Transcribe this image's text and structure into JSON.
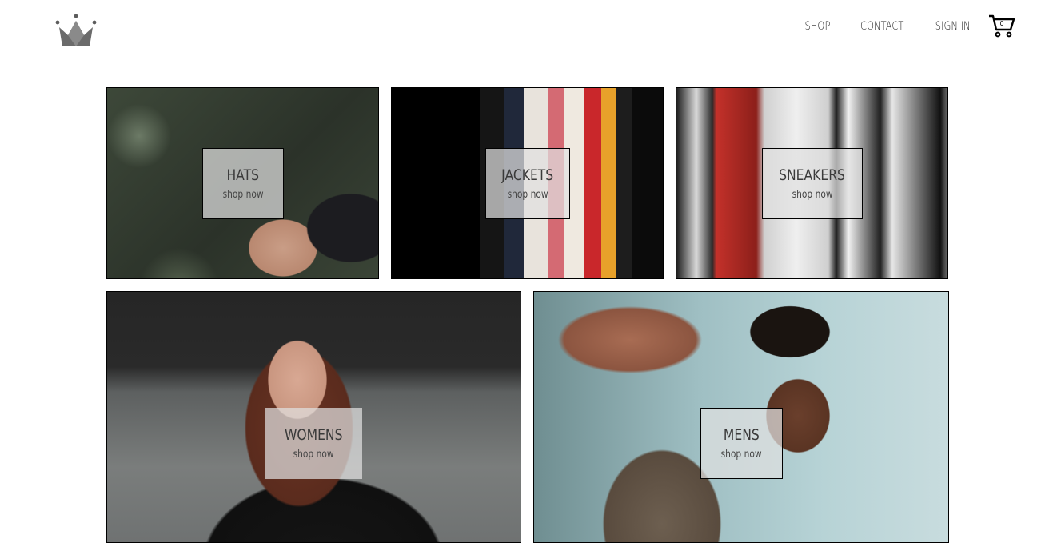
{
  "header": {
    "logo_icon": "crown-icon",
    "nav": [
      {
        "label": "SHOP"
      },
      {
        "label": "CONTACT"
      },
      {
        "label": "SIGN IN"
      }
    ],
    "cart": {
      "icon": "shopping-cart-icon",
      "count": "0"
    }
  },
  "categories": [
    {
      "title": "HATS",
      "cta": "shop now"
    },
    {
      "title": "JACKETS",
      "cta": "shop now"
    },
    {
      "title": "SNEAKERS",
      "cta": "shop now"
    },
    {
      "title": "WOMENS",
      "cta": "shop now"
    },
    {
      "title": "MENS",
      "cta": "shop now"
    }
  ]
}
